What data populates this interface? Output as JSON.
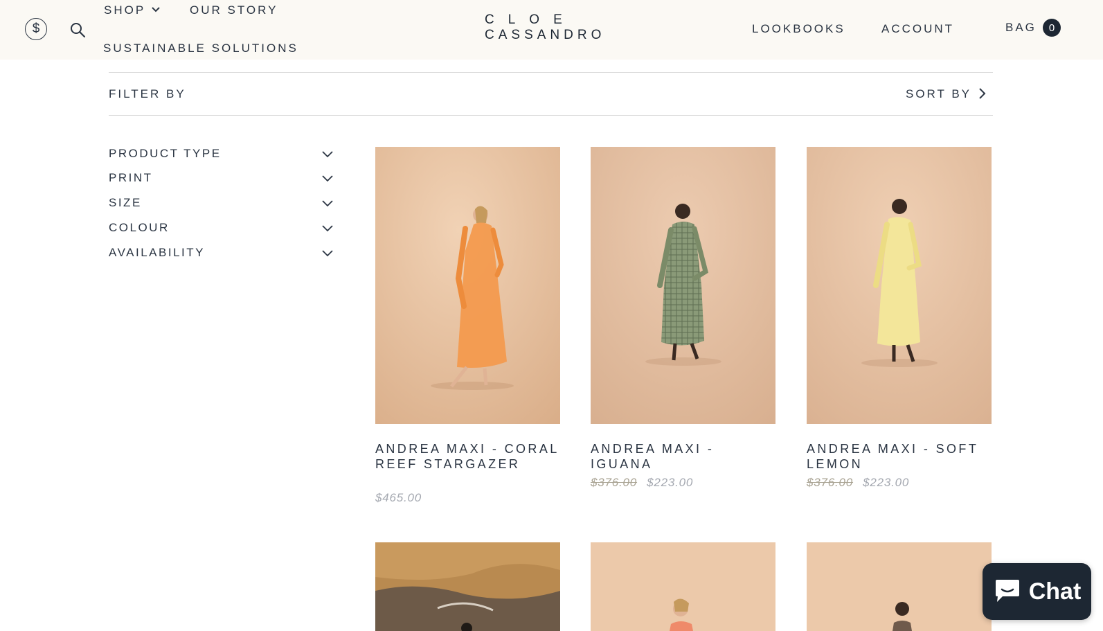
{
  "header": {
    "nav_left": {
      "shop": "SHOP",
      "our_story": "OUR STORY",
      "sustainable": "SUSTAINABLE SOLUTIONS"
    },
    "logo": {
      "line1": "CLOE",
      "line2": "CASSANDRO"
    },
    "nav_right": {
      "lookbooks": "LOOKBOOKS",
      "account": "ACCOUNT",
      "bag": "BAG",
      "bag_count": "0"
    },
    "icons": {
      "currency": "dollar-icon",
      "search": "search-icon"
    }
  },
  "filter_bar": {
    "filter_label": "FILTER BY",
    "sort_label": "SORT BY"
  },
  "filters": [
    {
      "label": "PRODUCT TYPE"
    },
    {
      "label": "PRINT"
    },
    {
      "label": "SIZE"
    },
    {
      "label": "COLOUR"
    },
    {
      "label": "AVAILABILITY"
    }
  ],
  "products": [
    {
      "title": "ANDREA MAXI - CORAL REEF STARGAZER",
      "price": "$465.00",
      "image": "model-in-orange-sheer-maxi-dress"
    },
    {
      "title": "ANDREA MAXI - IGUANA",
      "price_old": "$376.00",
      "price": "$223.00",
      "image": "model-in-green-check-maxi-dress"
    },
    {
      "title": "ANDREA MAXI - SOFT LEMON",
      "price_old": "$376.00",
      "price": "$223.00",
      "image": "model-in-pale-yellow-maxi-dress"
    }
  ],
  "chat": {
    "label": "Chat",
    "icon": "chat-bubble-icon"
  },
  "colors": {
    "header_bg": "#fbf9f4",
    "text_dark": "#2a3442",
    "brand_navy": "#1d2733",
    "price_grey": "#a4a8b0",
    "backdrop": "#e2bfa0"
  }
}
